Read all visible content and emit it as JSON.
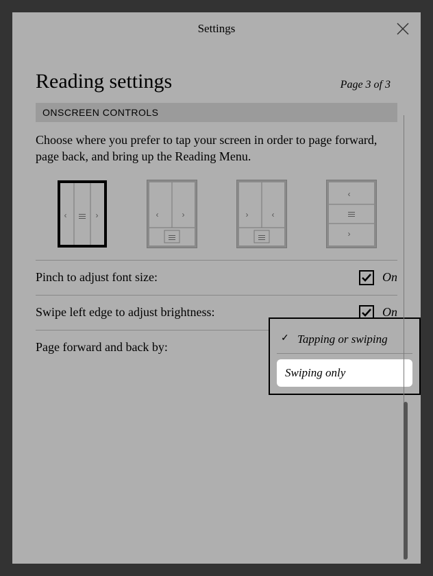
{
  "titlebar": {
    "title": "Settings"
  },
  "heading": "Reading settings",
  "page_indicator": "Page 3 of 3",
  "section_header": "ONSCREEN CONTROLS",
  "instruction": "Choose where you prefer to tap your screen in order to page forward, page back, and bring up the Reading Menu.",
  "layout_options": {
    "selected_index": 0,
    "count": 4
  },
  "options": {
    "pinch": {
      "label": "Pinch to adjust font size:",
      "checked": true,
      "state": "On"
    },
    "swipe_bright": {
      "label": "Swipe left edge to adjust brightness:",
      "checked": true,
      "state": "On"
    },
    "page_method": {
      "label": "Page forward and back by:",
      "selected": "Tapping or swiping",
      "items": [
        "Tapping or swiping",
        "Swiping only"
      ]
    }
  }
}
